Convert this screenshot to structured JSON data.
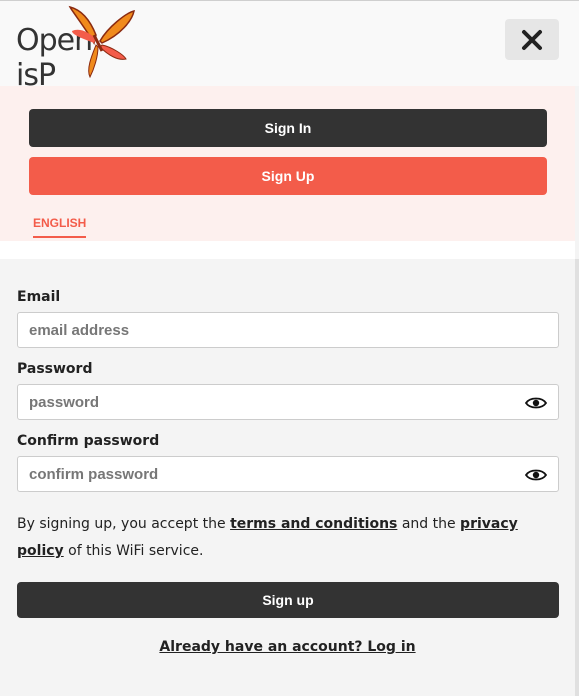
{
  "header": {
    "logo_text_left": "Open",
    "logo_text_right": "isP",
    "close_icon": "close-icon"
  },
  "menu": {
    "sign_in_label": "Sign In",
    "sign_up_label": "Sign Up",
    "language": "ENGLISH"
  },
  "form": {
    "email": {
      "label": "Email",
      "placeholder": "email address",
      "value": ""
    },
    "password": {
      "label": "Password",
      "placeholder": "password",
      "value": ""
    },
    "confirm_password": {
      "label": "Confirm password",
      "placeholder": "confirm password",
      "value": ""
    },
    "terms": {
      "prefix": "By signing up, you accept the ",
      "terms_link": "terms and conditions",
      "middle": " and the ",
      "privacy_link": "privacy policy",
      "suffix": " of this WiFi service."
    },
    "submit_label": "Sign up",
    "login_link": "Already have an account? Log in"
  },
  "colors": {
    "accent": "#f35c4a",
    "dark": "#333333",
    "menu_bg": "#fdf0ee",
    "form_bg": "#f4f4f4"
  },
  "icons": [
    "close-icon",
    "eye-icon",
    "butterfly-logo"
  ]
}
